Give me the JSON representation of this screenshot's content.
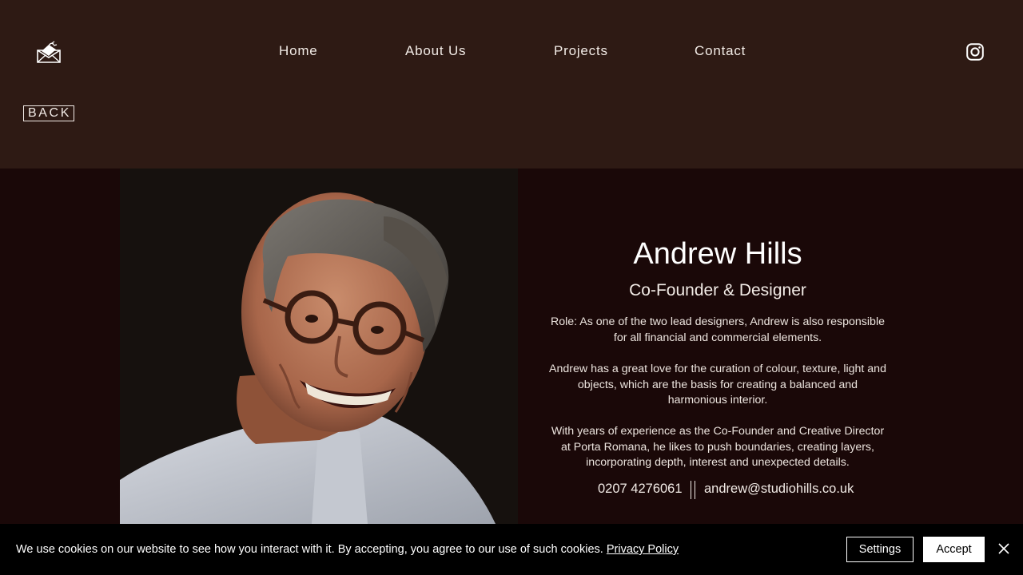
{
  "header": {
    "logo_icon": "envelope-heart-icon",
    "nav": {
      "home": "Home",
      "about": "About Us",
      "projects": "Projects",
      "contact": "Contact"
    },
    "social_icon": "instagram-icon",
    "back_label": "BACK"
  },
  "profile": {
    "photo_alt": "portrait-photo",
    "name": "Andrew Hills",
    "title": "Co-Founder & Designer",
    "paragraphs": [
      "Role: As one of the two lead designers, Andrew is also responsible for all financial and commercial elements.",
      "Andrew has a great love for the curation of colour, texture, light and objects, which are the basis for creating a balanced and harmonious interior.",
      "With years of experience as the Co-Founder and Creative Director at Porta Romana, he likes to push boundaries, creating layers, incorporating depth, interest and unexpected details."
    ],
    "phone": "0207 4276061",
    "email": "andrew@studiohills.co.uk"
  },
  "cookie_banner": {
    "text": "We use cookies on our website to see how you interact with it. By accepting, you agree to our use of such cookies.",
    "policy_link": "Privacy Policy",
    "settings_label": "Settings",
    "accept_label": "Accept",
    "close_icon": "close-icon"
  },
  "colors": {
    "header_bg": "#2e1a14",
    "content_bg": "#1a0808",
    "banner_bg": "#000000",
    "text": "#ffffff"
  }
}
